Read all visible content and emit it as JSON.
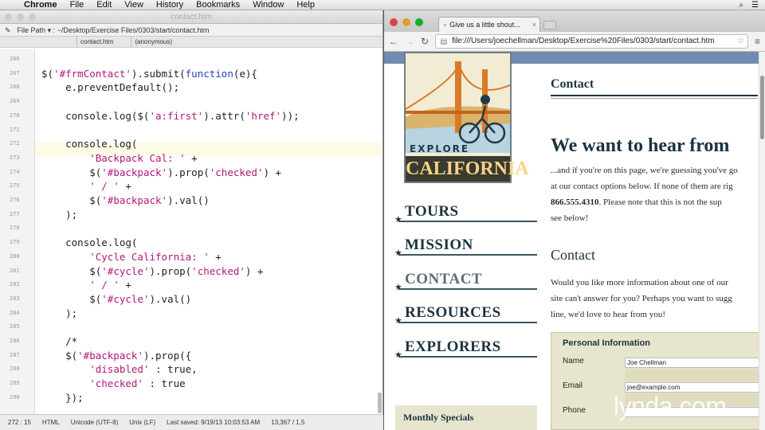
{
  "menubar": {
    "apple": "",
    "items": [
      "Chrome",
      "File",
      "Edit",
      "View",
      "History",
      "Bookmarks",
      "Window",
      "Help"
    ]
  },
  "editor": {
    "title": "contact.htm",
    "toolbar": {
      "file_path": "File Path ▾ : ~/Desktop/Exercise Files/0303/start/contact.htm"
    },
    "tabs": {
      "file": "contact.htm",
      "scope": "(anonymous)"
    },
    "lines": [
      {
        "n": "266",
        "t": ""
      },
      {
        "n": "267",
        "t": "$('#frmContact').submit(function(e){"
      },
      {
        "n": "268",
        "t": "    e.preventDefault();"
      },
      {
        "n": "269",
        "t": ""
      },
      {
        "n": "270",
        "t": "    console.log($('a:first').attr('href'));"
      },
      {
        "n": "271",
        "t": ""
      },
      {
        "n": "272",
        "t": "    console.log("
      },
      {
        "n": "273",
        "t": "        'Backpack Cal: ' +"
      },
      {
        "n": "274",
        "t": "        $('#backpack').prop('checked') +"
      },
      {
        "n": "275",
        "t": "        ' / ' +"
      },
      {
        "n": "276",
        "t": "        $('#backpack').val()"
      },
      {
        "n": "277",
        "t": "    );"
      },
      {
        "n": "278",
        "t": ""
      },
      {
        "n": "279",
        "t": "    console.log("
      },
      {
        "n": "280",
        "t": "        'Cycle California: ' +"
      },
      {
        "n": "281",
        "t": "        $('#cycle').prop('checked') +"
      },
      {
        "n": "282",
        "t": "        ' / ' +"
      },
      {
        "n": "283",
        "t": "        $('#cycle').val()"
      },
      {
        "n": "284",
        "t": "    );"
      },
      {
        "n": "285",
        "t": ""
      },
      {
        "n": "286",
        "t": "    /*"
      },
      {
        "n": "287",
        "t": "    $('#backpack').prop({"
      },
      {
        "n": "288",
        "t": "        'disabled' : true,"
      },
      {
        "n": "289",
        "t": "        'checked' : true"
      },
      {
        "n": "290",
        "t": "    });"
      }
    ],
    "status": {
      "pos": "272 : 15",
      "lang": "HTML",
      "encoding": "Unicode (UTF-8)",
      "line_endings": "Unix (LF)",
      "saved": "Last saved: 9/19/13 10:03:53 AM",
      "size": "13,367 / 1,5"
    }
  },
  "browser": {
    "tab_title": "Give us a little shout...",
    "url": "file:///Users/joechellman/Desktop/Exercise%20Files/0303/start/contact.htm",
    "logo": {
      "explore": "EXPLORE",
      "california": "CALIFORNIA"
    },
    "nav": [
      "TOURS",
      "MISSION",
      "CONTACT",
      "RESOURCES",
      "EXPLORERS"
    ],
    "specials": "Monthly Specials",
    "content": {
      "heading": "Contact",
      "headline": "We want to hear from",
      "para1_l1": "...and if you're on this page, we're guessing you've go",
      "para1_l2": "at our contact options below. If none of them are rig",
      "para1_l3_phone": "866.555.4310",
      "para1_l3_rest": ". Please note that this is not the sup",
      "para1_l4": "see below!",
      "subheading": "Contact",
      "para2_l1": "Would you like more information about one of our",
      "para2_l2": "site can't answer for you? Perhaps you want to sugg",
      "para2_l3": "line, we'd love to hear from you!"
    },
    "form": {
      "legend": "Personal Information",
      "name_label": "Name",
      "name_value": "Joe Chellman",
      "email_label": "Email",
      "email_value": "joe@example.com",
      "phone_label": "Phone"
    }
  },
  "watermark": "lynda.com"
}
